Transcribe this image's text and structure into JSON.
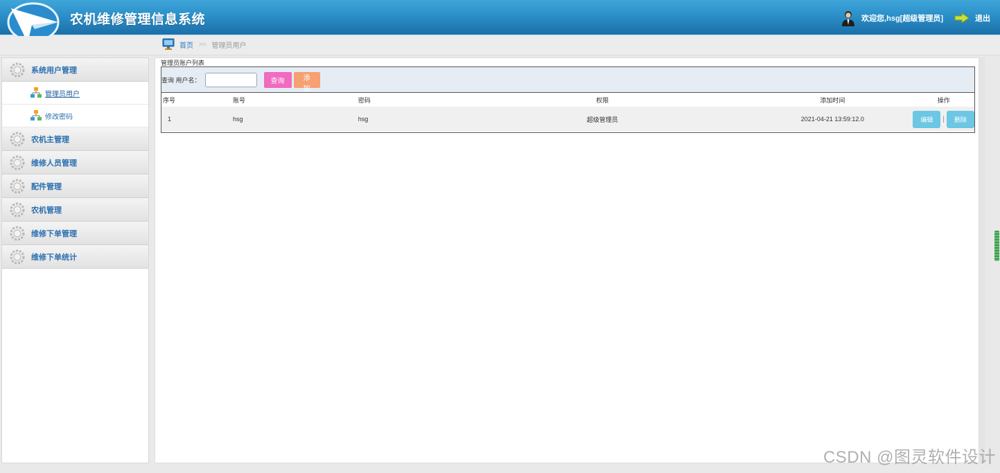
{
  "header": {
    "app_title": "农机维修管理信息系统",
    "welcome_text": "欢迎您,hsg[超级管理员]",
    "logout_label": "退出"
  },
  "breadcrumb": {
    "home": "首页",
    "separator": ">>",
    "current": "管理员用户"
  },
  "sidebar": {
    "groups": [
      {
        "label": "系统用户管理",
        "icon": "gear-icon"
      },
      {
        "label": "农机主管理",
        "icon": "gear-icon"
      },
      {
        "label": "维修人员管理",
        "icon": "gear-icon"
      },
      {
        "label": "配件管理",
        "icon": "gear-icon"
      },
      {
        "label": "农机管理",
        "icon": "gear-icon"
      },
      {
        "label": "维修下单管理",
        "icon": "gear-icon"
      },
      {
        "label": "维修下单统计",
        "icon": "gear-icon"
      }
    ],
    "sub_items": [
      {
        "label": "管理员用户",
        "icon": "tree-icon",
        "active": true
      },
      {
        "label": "修改密码",
        "icon": "tree-icon",
        "active": false
      }
    ]
  },
  "main": {
    "panel_title": "管理员账户列表",
    "search": {
      "label": "查询 用户名：",
      "value": "",
      "query_button": "查询",
      "add_button": "添加"
    },
    "table": {
      "columns": [
        "序号",
        "账号",
        "密码",
        "权限",
        "添加时间",
        "操作"
      ],
      "rows": [
        {
          "index": "1",
          "account": "hsg",
          "password": "hsg",
          "permission": "超级管理员",
          "added_time": "2021-04-21 13:59:12.0",
          "edit_label": "编辑",
          "op_separator": "|",
          "delete_label": "删除"
        }
      ]
    }
  },
  "watermark": "CSDN @图灵软件设计",
  "colors": {
    "header_blue": "#2b8fc8",
    "query_button": "#f06ac0",
    "add_button": "#f7a072",
    "op_button": "#6bc7e3",
    "menu_text": "#2a6fb0"
  }
}
